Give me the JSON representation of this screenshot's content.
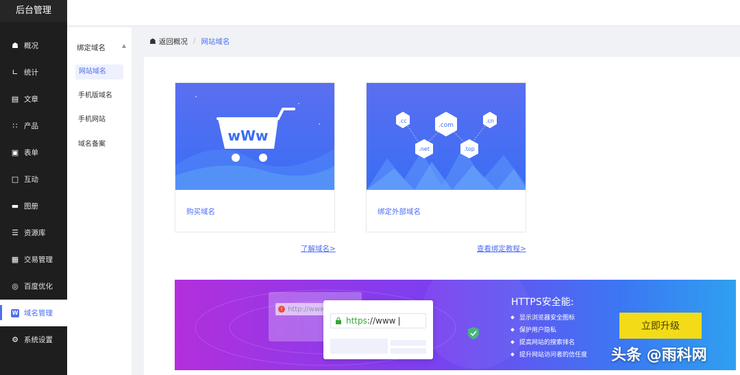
{
  "app": {
    "title": "后台管理"
  },
  "sidebar": {
    "items": [
      {
        "label": "概况",
        "icon": "home-icon"
      },
      {
        "label": "统计",
        "icon": "chart-icon"
      },
      {
        "label": "文章",
        "icon": "article-icon"
      },
      {
        "label": "产品",
        "icon": "product-icon"
      },
      {
        "label": "表单",
        "icon": "form-icon"
      },
      {
        "label": "互动",
        "icon": "comment-icon"
      },
      {
        "label": "图册",
        "icon": "gallery-icon"
      },
      {
        "label": "资源库",
        "icon": "database-icon"
      },
      {
        "label": "交易管理",
        "icon": "trade-icon"
      },
      {
        "label": "百度优化",
        "icon": "seo-icon"
      },
      {
        "label": "域名管理",
        "icon": "domain-icon",
        "active": true
      },
      {
        "label": "系统设置",
        "icon": "gear-icon"
      }
    ]
  },
  "subnav": {
    "heading": "绑定域名",
    "items": [
      "网站域名",
      "手机版域名",
      "手机网站",
      "域名备案"
    ],
    "selected": "网站域名"
  },
  "breadcrumb": {
    "back": "返回概况",
    "current": "网站域名"
  },
  "cards": [
    {
      "label": "购买域名",
      "art_text": "WWW",
      "link": "了解域名>"
    },
    {
      "label": "绑定外部域名",
      "tlds": [
        ".cc",
        ".com",
        ".cn",
        ".net",
        ".top"
      ],
      "link": "查看绑定教程>"
    }
  ],
  "banner": {
    "title": "HTTPS安全能:",
    "features": [
      "显示浏览器安全图标",
      "保护用户隐私",
      "提高网站的搜索排名",
      "提升网站访问者的信任度"
    ],
    "button": "立即升级",
    "url_old": "http://www",
    "url_new_scheme": "https",
    "url_new_rest": "://www"
  },
  "watermark": "头条 @雨科网",
  "colors": {
    "accent": "#4e6ef2",
    "sidebar": "#1e1e1e",
    "button": "#f3dc17"
  }
}
